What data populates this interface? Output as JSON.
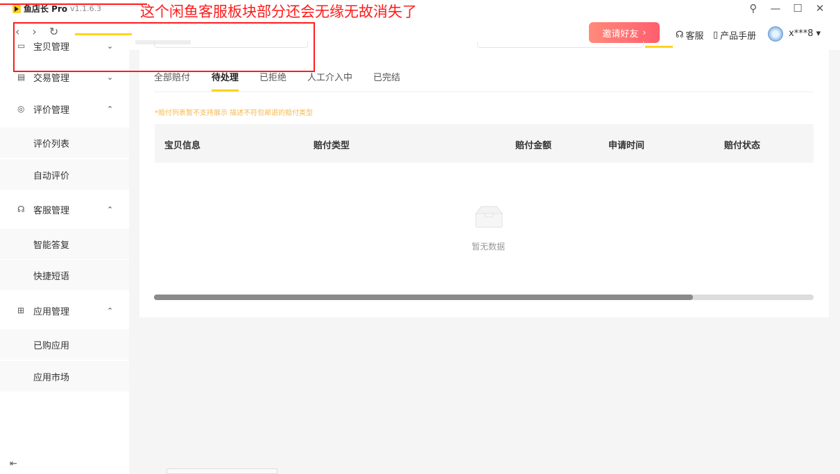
{
  "app": {
    "name": "鱼店长 Pro",
    "version": "v1.1.6.3"
  },
  "annotation": {
    "text": "这个闲鱼客服板块部分还会无缘无故消失了"
  },
  "window": {
    "pin": "⚲",
    "minimize": "—",
    "maximize": "☐",
    "close": "✕"
  },
  "header": {
    "back": "‹",
    "forward": "›",
    "refresh": "↻",
    "invite": "邀请好友",
    "service": "客服",
    "manual": "产品手册",
    "user": "x***8"
  },
  "sidebar": {
    "items": [
      {
        "icon": "▭",
        "label": "宝贝管理",
        "chev": "⌄"
      },
      {
        "icon": "▤",
        "label": "交易管理",
        "chev": "⌄"
      },
      {
        "icon": "◎",
        "label": "评价管理",
        "chev": "⌃"
      },
      {
        "icon": "☊",
        "label": "客服管理",
        "chev": "⌃"
      },
      {
        "icon": "⊞",
        "label": "应用管理",
        "chev": "⌃"
      }
    ],
    "sub": {
      "review_list": "评价列表",
      "auto_review": "自动评价",
      "smart_reply": "智能答复",
      "quick_phrase": "快捷短语",
      "bought_apps": "已购应用",
      "app_market": "应用市场"
    },
    "collapse": "⇤"
  },
  "tabs": [
    "全部赔付",
    "待处理",
    "已拒绝",
    "人工介入中",
    "已完结"
  ],
  "notice": "*赔付列表暂不支持展示 描述不符包邮退的赔付类型",
  "table": {
    "headers": [
      "宝贝信息",
      "赔付类型",
      "赔付金额",
      "申请时间",
      "赔付状态"
    ]
  },
  "empty": "暂无数据",
  "colors": {
    "accent": "#ffd21f",
    "annotation": "#ff1a1a",
    "invite_start": "#ff8a7a",
    "invite_end": "#ff5e6e"
  }
}
